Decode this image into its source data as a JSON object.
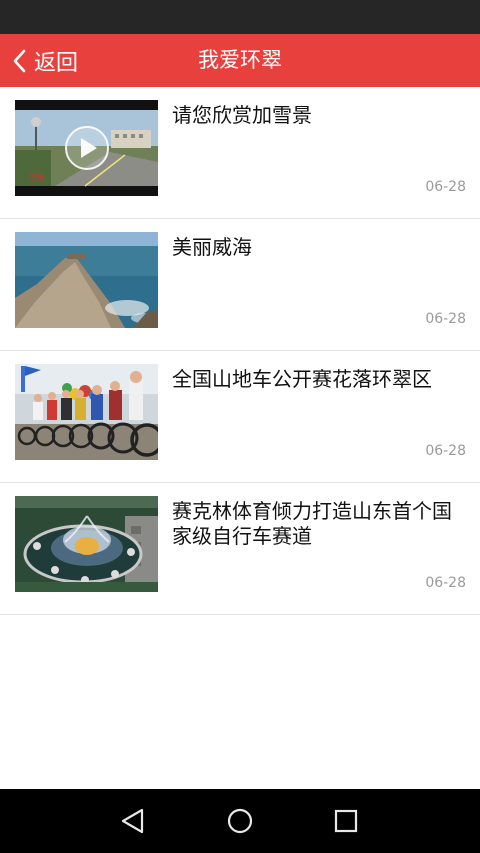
{
  "app_bar": {
    "back_label": "返回",
    "title": "我爱环翠",
    "color": "#e8403c"
  },
  "news": [
    {
      "title": "请您欣赏加雪景",
      "date": "06-28",
      "thumbnail": "road-video-thumbnail",
      "has_play_icon": true
    },
    {
      "title": "美丽威海",
      "date": "06-28",
      "thumbnail": "coastline-photo"
    },
    {
      "title": "全国山地车公开赛花落环翠区",
      "date": "06-28",
      "thumbnail": "cyclists-photo"
    },
    {
      "title": "赛克林体育倾力打造山东首个国家级自行车赛道",
      "date": "06-28",
      "thumbnail": "fountain-photo"
    }
  ],
  "nav_bar": {
    "icons": [
      "back-triangle-icon",
      "home-circle-icon",
      "recents-square-icon"
    ]
  }
}
